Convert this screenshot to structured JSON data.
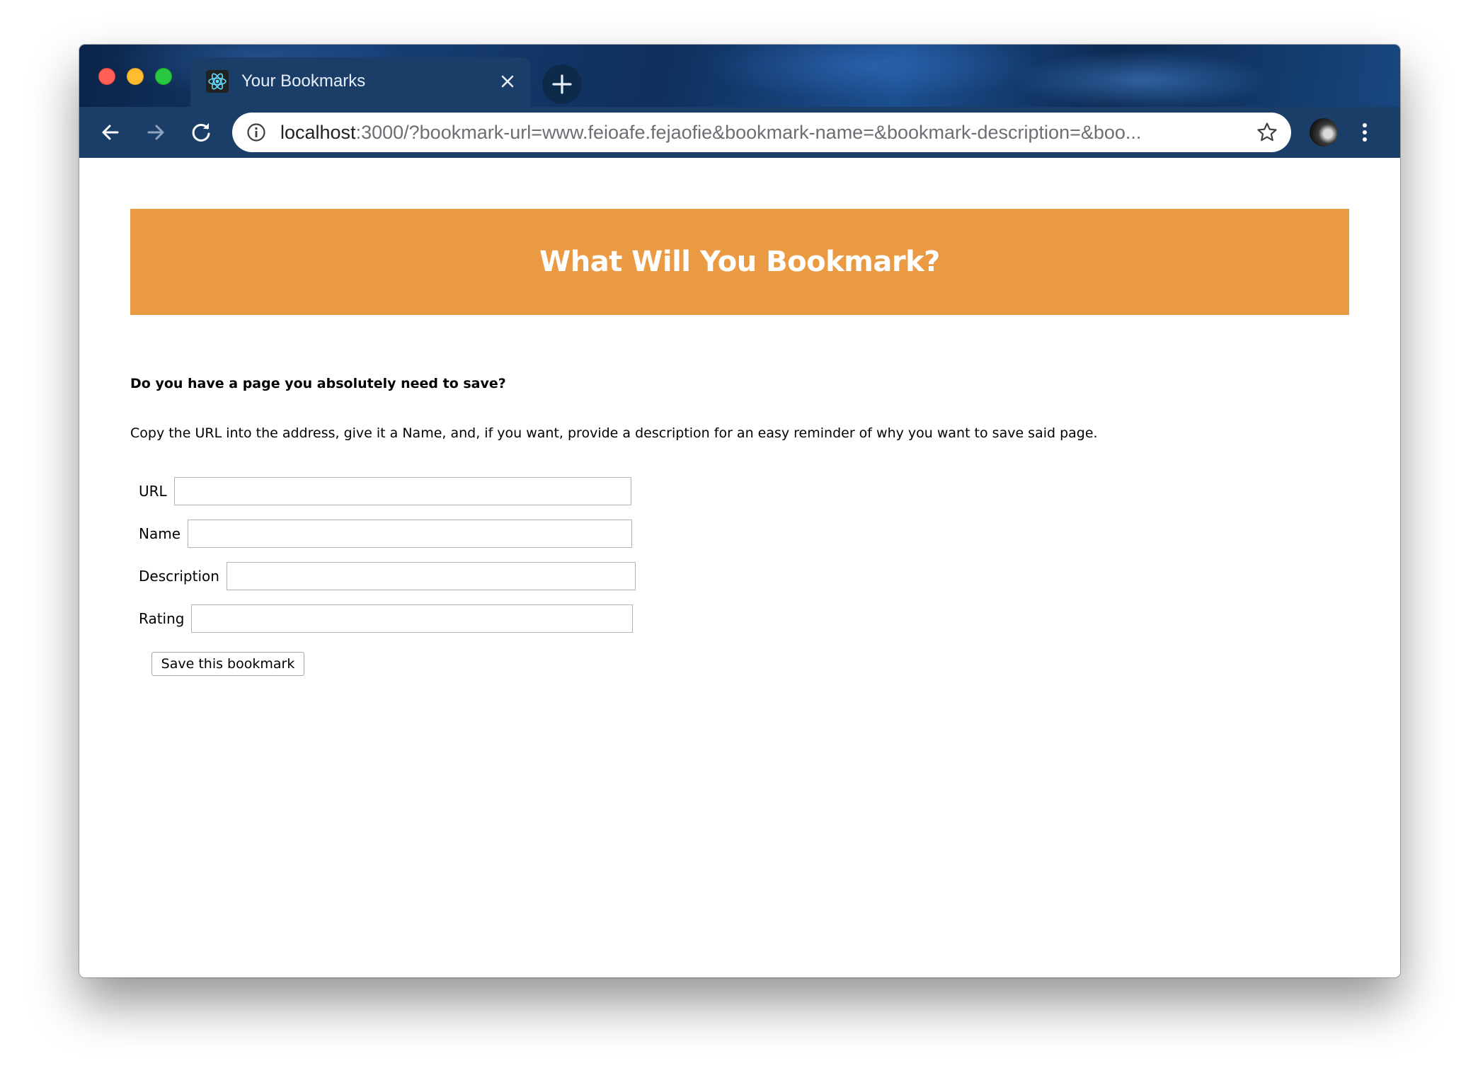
{
  "browser": {
    "tab": {
      "title": "Your Bookmarks",
      "favicon": "react-logo-icon"
    },
    "new_tab_icon": "plus-icon",
    "address_bar": {
      "host": "localhost",
      "rest": ":3000/?bookmark-url=www.feioafe.fejaofie&bookmark-name=&bookmark-description=&boo..."
    },
    "icons": {
      "back": "arrow-left-icon",
      "forward": "arrow-right-icon",
      "reload": "reload-icon",
      "info": "info-icon",
      "bookmark": "star-icon",
      "menu": "kebab-menu-icon"
    },
    "colors": {
      "tab_strip": "#163e74",
      "toolbar": "#1b3e69"
    }
  },
  "page": {
    "banner": {
      "title": "What Will You Bookmark?",
      "color": "#eb9a44"
    },
    "question": "Do you have a page you absolutely need to save?",
    "instructions": "Copy the URL into the address, give it a Name, and, if you want, provide a description for an easy reminder of why you want to save said page.",
    "form": {
      "url_label": "URL",
      "url_value": "",
      "name_label": "Name",
      "name_value": "",
      "description_label": "Description",
      "description_value": "",
      "rating_label": "Rating",
      "rating_value": "",
      "submit_label": "Save this bookmark"
    }
  }
}
